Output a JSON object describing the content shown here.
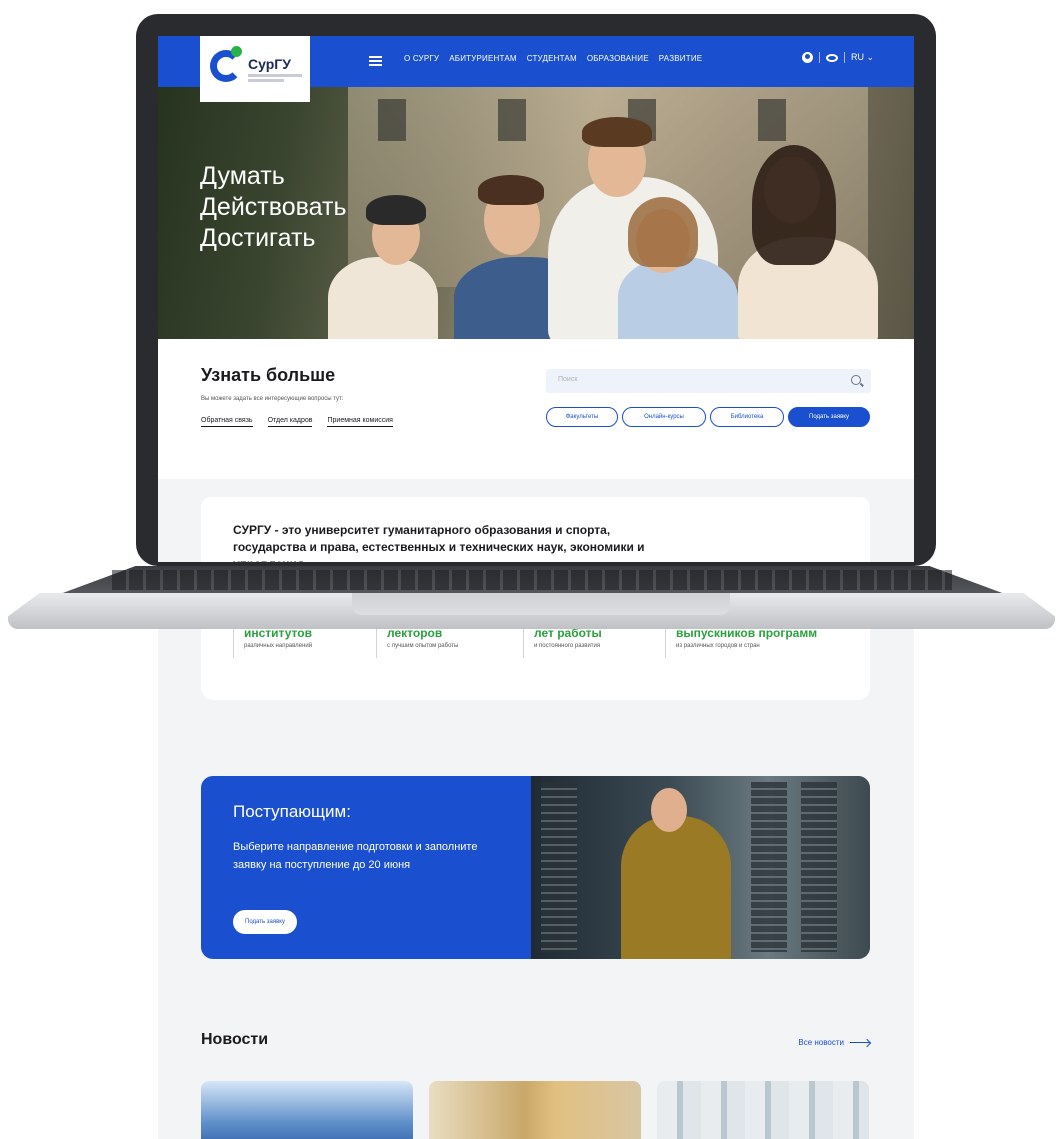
{
  "header": {
    "logo_text": "СурГУ",
    "menu": [
      "О СУРГУ",
      "АБИТУРИЕНТАМ",
      "СТУДЕНТАМ",
      "ОБРАЗОВАНИЕ",
      "РАЗВИТИЕ"
    ],
    "lang": "RU ⌄"
  },
  "hero": {
    "lines": [
      "Думать",
      "Действовать",
      "Достигать"
    ]
  },
  "learn": {
    "title": "Узнать больше",
    "subtitle": "Вы можете задать все интересующие вопросы тут:",
    "links": [
      "Обратная связь",
      "Отдел кадров",
      "Приемная комиссия"
    ],
    "search_placeholder": "Поиск",
    "pills": [
      "Факультеты",
      "Онлайн-курсы",
      "Библиотека"
    ],
    "cta": "Подать заявку"
  },
  "about": {
    "text": "СУРГУ - это университет гуманитарного образования и спорта, государства и права, естественных и технических наук, экономики и управления,"
  },
  "stats": [
    {
      "title": "институтов",
      "sub": "различных направлений"
    },
    {
      "title": "лекторов",
      "sub": "с лучшим опытом работы"
    },
    {
      "title": "лет работы",
      "sub": "и постоянного развития"
    },
    {
      "title": "выпускников программ",
      "sub": "из различных городов и стран"
    }
  ],
  "promo": {
    "title": "Поступающим:",
    "text": "Выберите направление подготовки и заполните заявку на поступление до 20 июня",
    "button": "Подать заявку"
  },
  "news": {
    "title": "Новости",
    "all": "Все новости"
  },
  "colors": {
    "brand_blue": "#1a4fcf",
    "accent_green": "#2aa03e"
  }
}
